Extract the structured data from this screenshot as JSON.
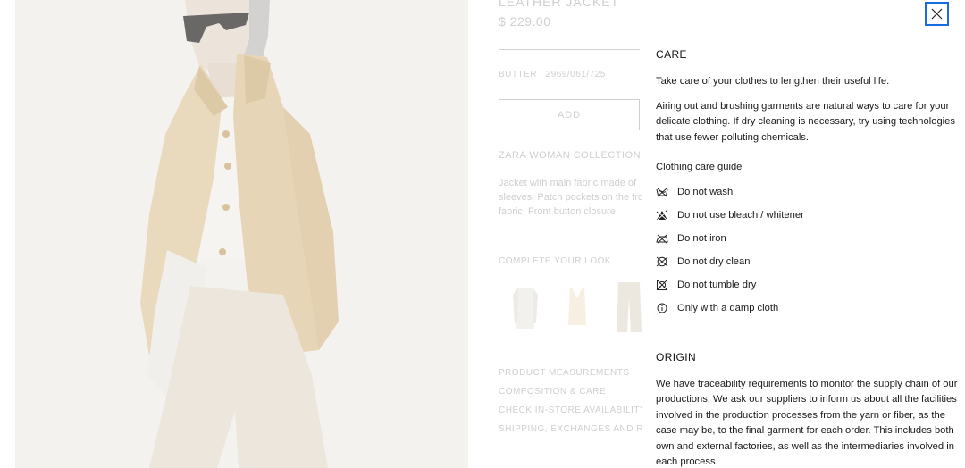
{
  "product": {
    "title": "LEATHER JACKET",
    "price": "$ 229.00",
    "reference": "BUTTER | 2969/061/725",
    "add_label": "ADD",
    "collection": "ZARA WOMAN COLLECTION",
    "description_lines": [
      "Jacket with main fabric made of",
      "sleeves. Patch pockets on the fro",
      "fabric. Front button closure."
    ],
    "complete_look_label": "COMPLETE YOUR LOOK",
    "links": [
      "PRODUCT MEASUREMENTS",
      "COMPOSITION & CARE",
      "CHECK IN-STORE AVAILABILITY",
      "SHIPPING, EXCHANGES AND RETU"
    ]
  },
  "care": {
    "heading": "CARE",
    "intro": "Take care of your clothes to lengthen their useful life.",
    "body_lines": [
      "Airing out and brushing garments are natural ways to care for your",
      "delicate clothing. If dry cleaning is necessary, try using technologies",
      "that use fewer polluting chemicals."
    ],
    "guide_link": "Clothing care guide",
    "instructions": [
      {
        "icon": "no-wash-icon",
        "label": "Do not wash"
      },
      {
        "icon": "no-bleach-icon",
        "label": "Do not use bleach / whitener"
      },
      {
        "icon": "no-iron-icon",
        "label": "Do not iron"
      },
      {
        "icon": "no-dry-clean-icon",
        "label": "Do not dry clean"
      },
      {
        "icon": "no-tumble-dry-icon",
        "label": "Do not tumble dry"
      },
      {
        "icon": "info-icon",
        "label": "Only with a damp cloth"
      }
    ]
  },
  "origin": {
    "heading": "ORIGIN",
    "body_lines": [
      "We have traceability requirements to monitor the supply chain of our",
      "productions. We ask our suppliers to inform us about all the facilities",
      "involved in the production processes from the yarn or fiber, as the",
      "case may be, to the final garment for each order. This includes both",
      "own and external factories, as well as the intermediaries involved in",
      "each process."
    ]
  },
  "colors": {
    "focus_ring": "#1a6ae0",
    "dimmed_text": "#cfcfcf",
    "jacket": "#e9d9bd"
  },
  "icons": {
    "close": "close-icon"
  }
}
